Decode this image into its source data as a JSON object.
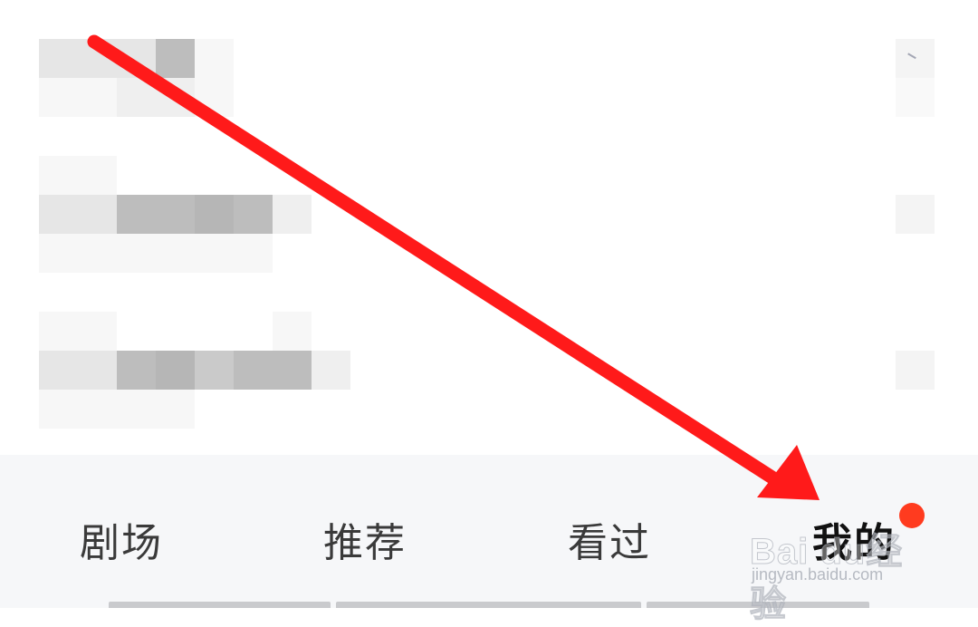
{
  "tabs": [
    {
      "label": "剧场",
      "active": false
    },
    {
      "label": "推荐",
      "active": false
    },
    {
      "label": "看过",
      "active": false
    },
    {
      "label": "我的",
      "active": true,
      "badge": true
    }
  ],
  "colors": {
    "arrow": "#ff1a1a",
    "badge": "#ff3b1f",
    "tab_bar_bg": "#f6f7f9",
    "active_tab": "#111111",
    "inactive_tab": "#3a3a3a"
  },
  "watermark": {
    "logo": "Bai du经验",
    "url": "jingyan.baidu.com"
  }
}
